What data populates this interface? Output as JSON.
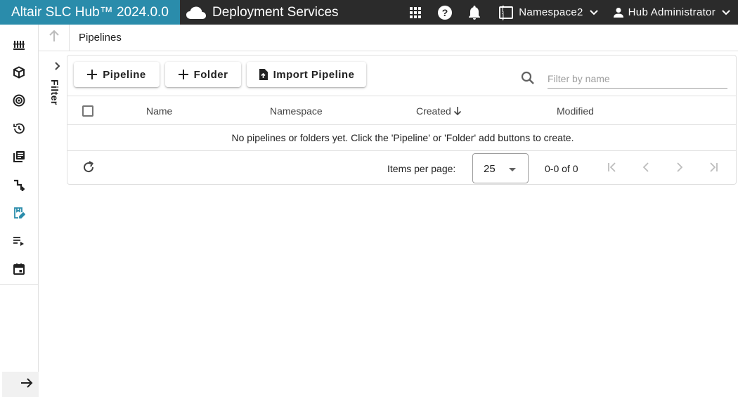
{
  "header": {
    "brand": "Altair SLC Hub™ 2024.0.0",
    "service": "Deployment Services",
    "namespace": "Namespace2",
    "user": "Hub Administrator",
    "brand_color": "#2a8cab",
    "bar_color": "#2b2b2b"
  },
  "rail": {
    "items": [
      {
        "icon": "dashboard-bars-icon"
      },
      {
        "icon": "package-cube-icon"
      },
      {
        "icon": "target-icon"
      },
      {
        "icon": "history-clock-icon"
      },
      {
        "icon": "library-books-icon"
      },
      {
        "icon": "step-arrows-icon"
      },
      {
        "icon": "pipeline-edit-icon",
        "active": true
      },
      {
        "icon": "playlist-play-icon"
      },
      {
        "icon": "calendar-icon"
      }
    ],
    "active_color": "#2a8cab"
  },
  "breadcrumb": {
    "title": "Pipelines"
  },
  "filter_panel": {
    "label": "Filter"
  },
  "toolbar": {
    "add_pipeline_label": "Pipeline",
    "add_folder_label": "Folder",
    "import_label": "Import Pipeline",
    "filter_placeholder": "Filter by name"
  },
  "table": {
    "columns": [
      "Name",
      "Namespace",
      "Created",
      "Modified"
    ],
    "empty_message": "No pipelines or folders yet. Click the 'Pipeline' or 'Folder' add buttons to create."
  },
  "pagination": {
    "items_per_page_label": "Items per page:",
    "items_per_page_value": "25",
    "range": "0-0 of 0"
  }
}
